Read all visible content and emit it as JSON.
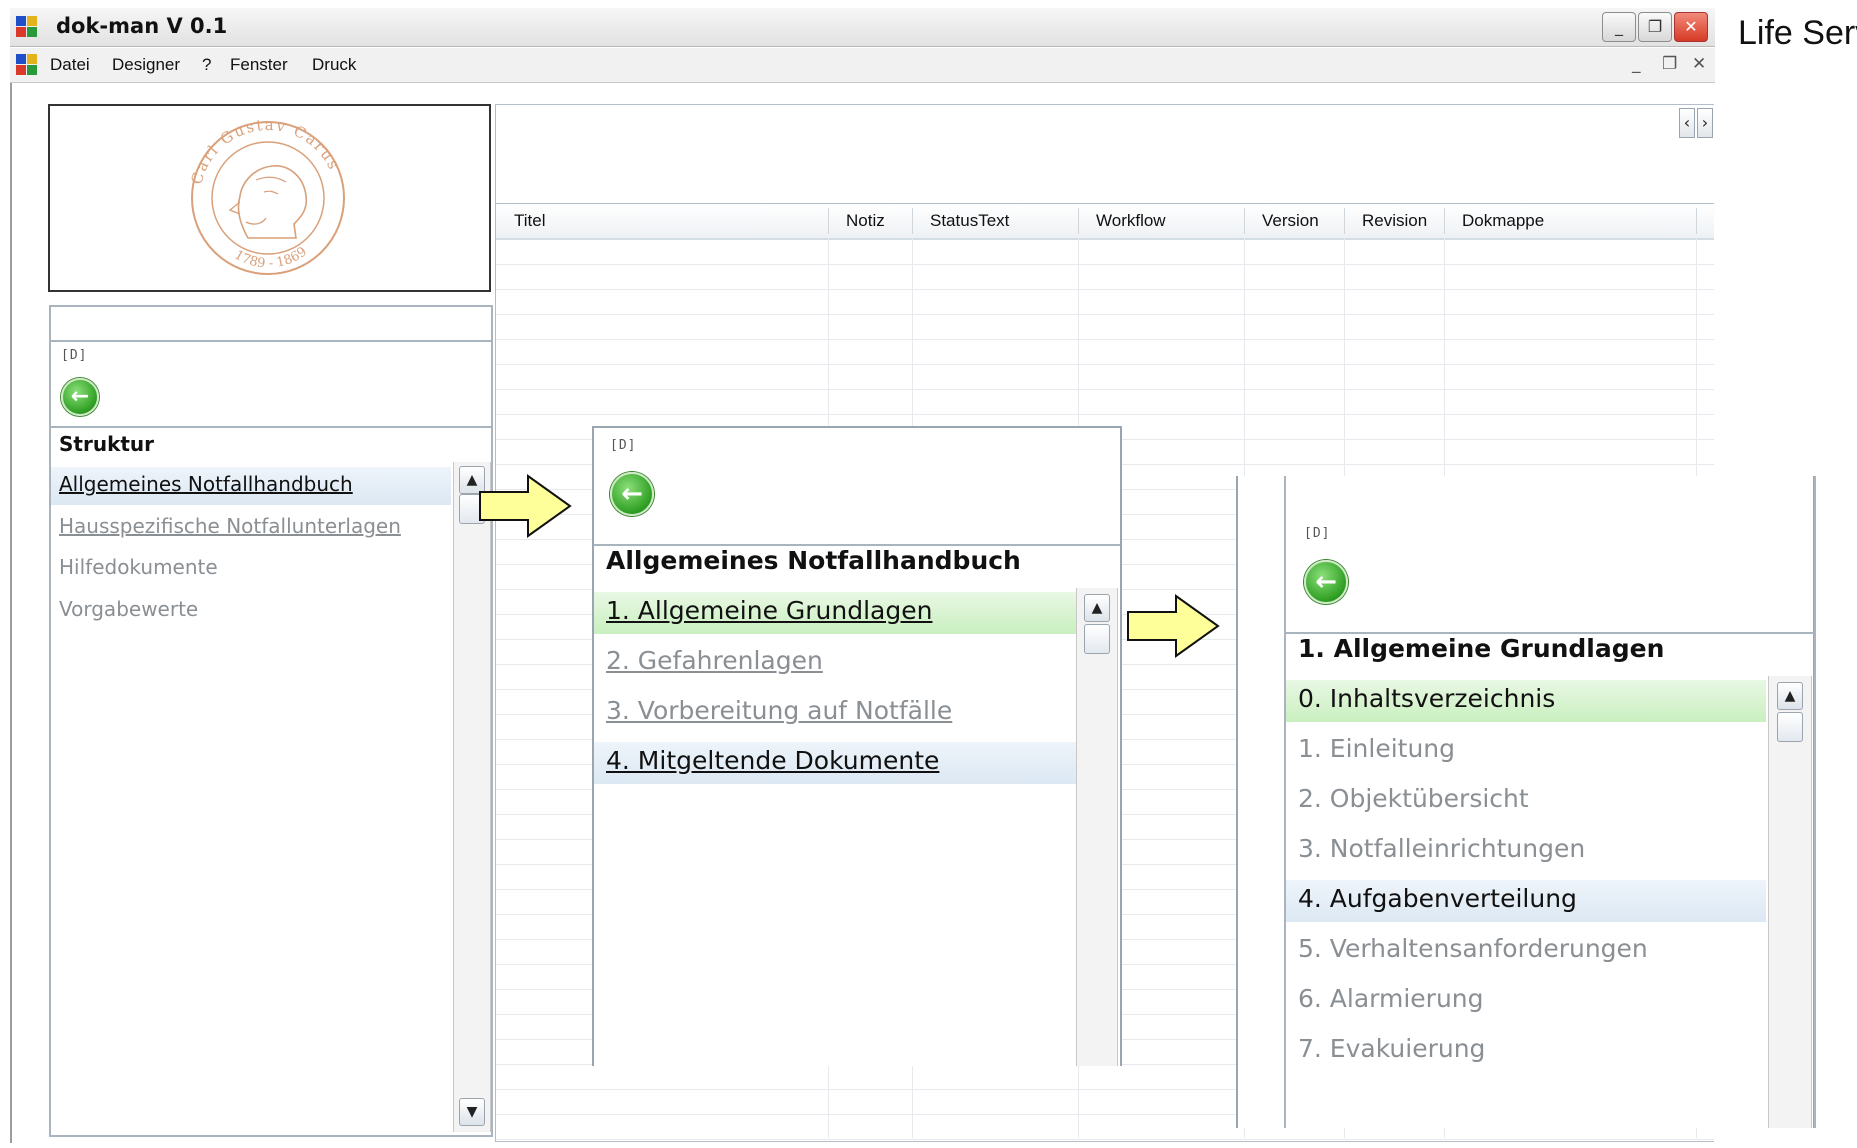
{
  "window": {
    "title": "dok-man V 0.1",
    "minimize": "_",
    "restore": "❐",
    "close": "✕"
  },
  "menu": {
    "items": [
      "Datei",
      "Designer",
      "?",
      "Fenster",
      "Druck"
    ],
    "mdi_minimize": "_",
    "mdi_restore": "❐",
    "mdi_close": "✕"
  },
  "corner_text": "Life Serv",
  "logo": {
    "top_text": "Carl Gustav Carus",
    "bottom_text": "1789 - 1869"
  },
  "panel_common": {
    "d_label": "[D]",
    "back_glyph": "←"
  },
  "sidebar": {
    "title": "Struktur",
    "items": [
      {
        "label": "Allgemeines Notfallhandbuch"
      },
      {
        "label": "Hausspezifische Notfallunterlagen"
      },
      {
        "label": "Hilfedokumente"
      },
      {
        "label": "Vorgabewerte"
      }
    ]
  },
  "grid": {
    "columns": [
      "Titel",
      "Notiz",
      "StatusText",
      "Workflow",
      "Version",
      "Revision",
      "Dokmappe"
    ],
    "nav_left": "‹",
    "nav_right": "›"
  },
  "panel2": {
    "title": "Allgemeines Notfallhandbuch",
    "items": [
      {
        "label": "1. Allgemeine Grundlagen"
      },
      {
        "label": "2. Gefahrenlagen"
      },
      {
        "label": "3. Vorbereitung auf Notfälle"
      },
      {
        "label": "4. Mitgeltende Dokumente"
      }
    ]
  },
  "panel3": {
    "title": "1. Allgemeine Grundlagen",
    "items": [
      {
        "label": "0. Inhaltsverzeichnis"
      },
      {
        "label": "1. Einleitung"
      },
      {
        "label": "2. Objektübersicht"
      },
      {
        "label": "3. Notfalleinrichtungen"
      },
      {
        "label": "4. Aufgabenverteilung"
      },
      {
        "label": "5. Verhaltensanforderungen"
      },
      {
        "label": "6. Alarmierung"
      },
      {
        "label": "7. Evakuierung"
      }
    ]
  },
  "scroll": {
    "up": "▲",
    "down": "▼"
  },
  "colors": {
    "highlight_green": "#c9efbf",
    "highlight_blue": "#dce8f3",
    "arrow_fill": "#ffff99",
    "logo": "#d9a07a"
  }
}
